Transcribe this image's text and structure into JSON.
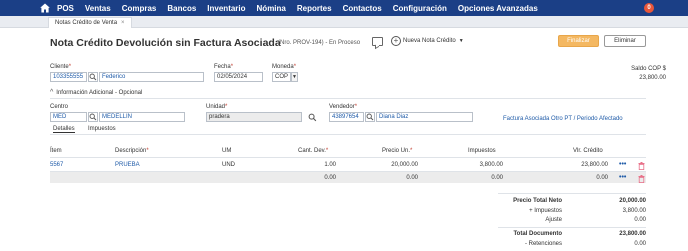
{
  "nav": {
    "items": [
      "POS",
      "Ventas",
      "Compras",
      "Bancos",
      "Inventario",
      "Nómina",
      "Reportes",
      "Contactos",
      "Configuración",
      "Opciones Avanzadas"
    ],
    "notification_count": "0"
  },
  "tab": {
    "label": "Notas Crédito de Venta",
    "close": "×"
  },
  "header": {
    "title": "Nota Crédito Devolución sin Factura Asociada",
    "doc_number": "(Nro. PROV-194) - En Proceso",
    "new_note": "Nueva Nota Crédito",
    "finalize": "Finalizar",
    "delete": "Eliminar"
  },
  "form": {
    "cliente_label": "Cliente",
    "cliente_id": "103355555",
    "cliente_name": "Federico",
    "fecha_label": "Fecha",
    "fecha_value": "02/05/2024",
    "moneda_label": "Moneda",
    "moneda_value": "COP",
    "saldo_label": "Saldo COP $",
    "saldo_value": "23,800.00",
    "info_toggle": "Información Adicional - Opcional",
    "centro_label": "Centro",
    "centro_code": "MED",
    "centro_name": "MEDELLIN",
    "unidad_label": "Unidad",
    "unidad_value": "pradera",
    "vendedor_label": "Vendedor",
    "vendedor_id": "43897654",
    "vendedor_name": "Diana Diaz",
    "factura_link": "Factura Asociada Otro PT / Periodo Afectado"
  },
  "subtabs": [
    "Detalles",
    "Impuestos"
  ],
  "table": {
    "headers": [
      "Ítem",
      "Descripción",
      "UM",
      "Cant. Dev.",
      "Precio Un.",
      "Impuestos",
      "Vlr. Crédito"
    ],
    "rows": [
      [
        "5567",
        "PRUEBA",
        "UND",
        "1.00",
        "20,000.00",
        "3,800.00",
        "23,800.00"
      ],
      [
        "",
        "",
        "",
        "0.00",
        "0.00",
        "0.00",
        "0.00"
      ]
    ]
  },
  "totals": {
    "neto_label": "Precio Total Neto",
    "neto_value": "20,000.00",
    "impuestos_label": "+ Impuestos",
    "impuestos_value": "3,800.00",
    "ajuste_label": "Ajuste",
    "ajuste_value": "0.00",
    "total_label": "Total Documento",
    "total_value": "23,800.00",
    "retenciones_label": "- Retenciones",
    "retenciones_value": "0.00"
  },
  "colors": {
    "nav_bg": "#1b3f86",
    "link": "#1f5ba8",
    "finalize_bg": "#f4b862",
    "required": "#c0392b",
    "trash": "#e8728a"
  }
}
